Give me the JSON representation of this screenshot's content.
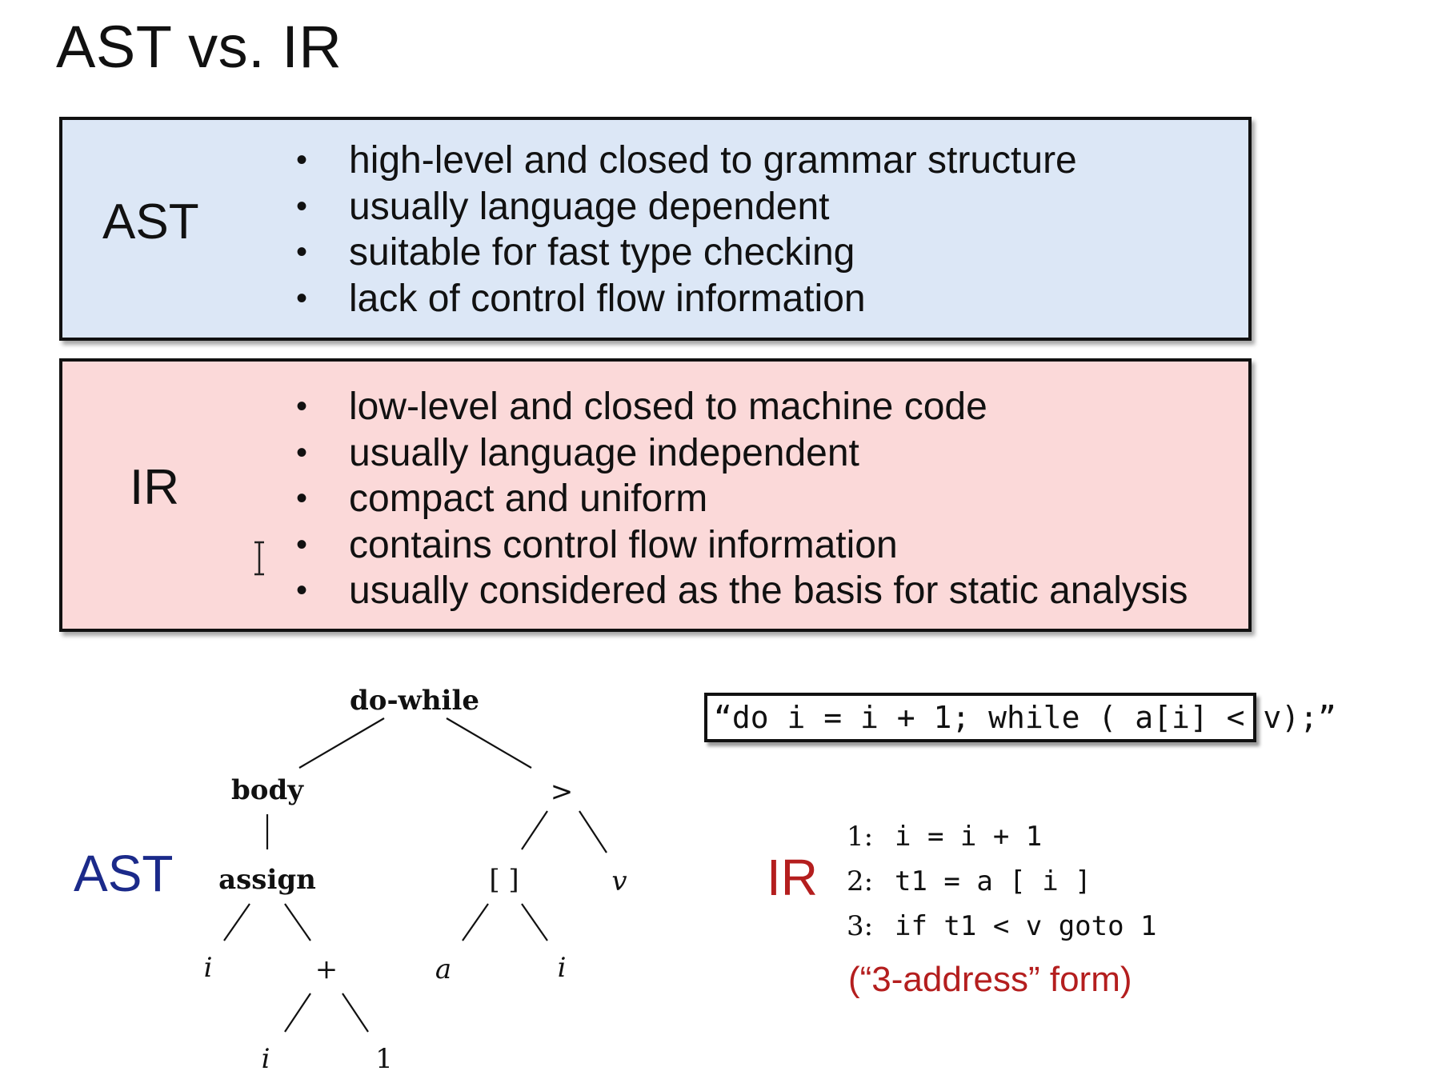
{
  "slide": {
    "title": "AST vs. IR"
  },
  "ast_box": {
    "label": "AST",
    "items": [
      "high-level and closed to grammar structure",
      "usually language dependent",
      "suitable for fast type checking",
      "lack of control flow information"
    ]
  },
  "ir_box": {
    "label": "IR",
    "items": [
      "low-level and closed to machine code",
      "usually language independent",
      "compact and uniform",
      "contains control flow information",
      "usually considered as the basis for static analysis"
    ]
  },
  "tree": {
    "label": "AST",
    "nodes": {
      "root": "do-while",
      "body": "body",
      "gt": ">",
      "assign": "assign",
      "index": "[ ]",
      "v": "v",
      "i1": "i",
      "plus": "+",
      "a": "a",
      "i2": "i",
      "i3": "i",
      "one": "1"
    }
  },
  "source_code": "“do i = i + 1;  while ( a[i] < v);”",
  "ir": {
    "label": "IR",
    "lines": [
      {
        "num": "1:",
        "code": "i = i + 1"
      },
      {
        "num": "2:",
        "code": "t1 = a [ i ]"
      },
      {
        "num": "3:",
        "code": "if t1 < v goto 1"
      }
    ],
    "note": "(“3-address” form)"
  },
  "colors": {
    "ast_box_bg": "#dce7f6",
    "ir_box_bg": "#fbd9d9",
    "ast_label": "#1b2a8a",
    "ir_label": "#b41e1e"
  }
}
